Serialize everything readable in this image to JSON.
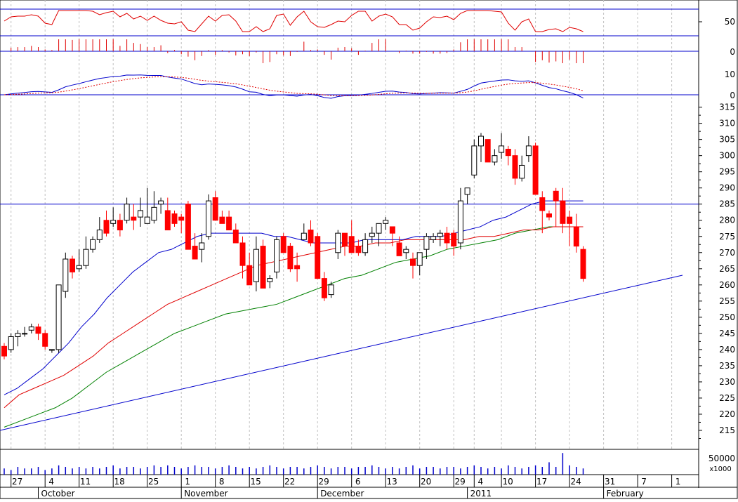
{
  "chart_data": {
    "type": "candlestick",
    "colors": {
      "up": "#ffffff",
      "down": "#ff0000",
      "ma_short": "#0000cc",
      "ma_mid": "#e00000",
      "ma_long": "#008000",
      "trendline": "#0000cc",
      "grid": "#c0c0c0",
      "rsi": "#e00000",
      "osc_bar": "#e00000",
      "macd": "#0000cc",
      "signal": "#e00000",
      "volume": "#0000cc"
    },
    "price_axis": {
      "min": 210,
      "max": 316,
      "ticks": [
        215,
        220,
        225,
        230,
        235,
        240,
        245,
        250,
        255,
        260,
        265,
        270,
        275,
        280,
        285,
        290,
        295,
        300,
        305,
        310,
        315
      ]
    },
    "rsi_panel": {
      "ticks": [
        50
      ],
      "level": 50
    },
    "osc_panel": {
      "ticks": [
        0
      ]
    },
    "macd_panel": {
      "ticks": [
        10,
        0
      ]
    },
    "volume_panel": {
      "ticks": [
        "50000"
      ],
      "unit": "x1000"
    },
    "date_ticks": [
      {
        "label": "27",
        "i": 1
      },
      {
        "label": "4",
        "i": 6
      },
      {
        "label": "11",
        "i": 11
      },
      {
        "label": "18",
        "i": 16
      },
      {
        "label": "25",
        "i": 21
      },
      {
        "label": "1",
        "i": 26
      },
      {
        "label": "8",
        "i": 31
      },
      {
        "label": "15",
        "i": 36
      },
      {
        "label": "22",
        "i": 41
      },
      {
        "label": "29",
        "i": 46
      },
      {
        "label": "6",
        "i": 51
      },
      {
        "label": "13",
        "i": 56
      },
      {
        "label": "20",
        "i": 61
      },
      {
        "label": "29",
        "i": 66
      },
      {
        "label": "4",
        "i": 69
      },
      {
        "label": "10",
        "i": 73
      },
      {
        "label": "17",
        "i": 78
      },
      {
        "label": "24",
        "i": 83
      },
      {
        "label": "31",
        "i": 88
      },
      {
        "label": "7",
        "i": 93
      },
      {
        "label": "1",
        "i": 98
      }
    ],
    "months": [
      {
        "label": "October",
        "i": 5
      },
      {
        "label": "November",
        "i": 26
      },
      {
        "label": "December",
        "i": 46
      },
      {
        "label": "2011",
        "i": 68
      },
      {
        "label": "February",
        "i": 88
      }
    ],
    "candles": [
      [
        241,
        242,
        237,
        238
      ],
      [
        240,
        245,
        239,
        244
      ],
      [
        244,
        246,
        241,
        245
      ],
      [
        245,
        247,
        244,
        245
      ],
      [
        246,
        248,
        245,
        247
      ],
      [
        247,
        248,
        243,
        245
      ],
      [
        245,
        246,
        240,
        241
      ],
      [
        240,
        240,
        239,
        240
      ],
      [
        240,
        260,
        239,
        260
      ],
      [
        258,
        270,
        256,
        268
      ],
      [
        268,
        269,
        262,
        264
      ],
      [
        265,
        271,
        264,
        266
      ],
      [
        266,
        275,
        265,
        271
      ],
      [
        271,
        275,
        270,
        274
      ],
      [
        274,
        281,
        273,
        277
      ],
      [
        280,
        283,
        275,
        276
      ],
      [
        279,
        284,
        278,
        280
      ],
      [
        280,
        282,
        275,
        277
      ],
      [
        280,
        287,
        279,
        285
      ],
      [
        281,
        285,
        277,
        280
      ],
      [
        281,
        287,
        278,
        283
      ],
      [
        279,
        290,
        279,
        281
      ],
      [
        280,
        289,
        279,
        284
      ],
      [
        285,
        287,
        282,
        286
      ],
      [
        283,
        287,
        280,
        277
      ],
      [
        282,
        283,
        278,
        279
      ],
      [
        281,
        282,
        276,
        280
      ],
      [
        285,
        286,
        271,
        271
      ],
      [
        272,
        276,
        271,
        268
      ],
      [
        271,
        276,
        267,
        273
      ],
      [
        275,
        288,
        274,
        286
      ],
      [
        287,
        289,
        281,
        280
      ],
      [
        281,
        283,
        279,
        279
      ],
      [
        281,
        283,
        278,
        277
      ],
      [
        277,
        279,
        274,
        273
      ],
      [
        273,
        275,
        262,
        266
      ],
      [
        266,
        270,
        260,
        260
      ],
      [
        261,
        275,
        258,
        271
      ],
      [
        272,
        274,
        259,
        259
      ],
      [
        261,
        263,
        259,
        262
      ],
      [
        264,
        275,
        262,
        274
      ],
      [
        275,
        276,
        270,
        270
      ],
      [
        272,
        273,
        264,
        265
      ],
      [
        266,
        270,
        261,
        265
      ],
      [
        274,
        279,
        274,
        276
      ],
      [
        277,
        280,
        272,
        273
      ],
      [
        275,
        276,
        262,
        262
      ],
      [
        262,
        264,
        255,
        256
      ],
      [
        257,
        261,
        256,
        260
      ],
      [
        270,
        277,
        268,
        276
      ],
      [
        276,
        276,
        269,
        272
      ],
      [
        275,
        280,
        271,
        270
      ],
      [
        272,
        274,
        269,
        270
      ],
      [
        270,
        276,
        269,
        274
      ],
      [
        275,
        278,
        273,
        276
      ],
      [
        276,
        279,
        272,
        279
      ],
      [
        279,
        281,
        277,
        280
      ],
      [
        278,
        278,
        272,
        276
      ],
      [
        273,
        275,
        269,
        269
      ],
      [
        270,
        272,
        268,
        271
      ],
      [
        268,
        270,
        262,
        266
      ],
      [
        266,
        268,
        263,
        270
      ],
      [
        271,
        276,
        268,
        275
      ],
      [
        274,
        276,
        273,
        275
      ],
      [
        275,
        277,
        272,
        276
      ],
      [
        276,
        278,
        271,
        273
      ],
      [
        276,
        277,
        269,
        272
      ],
      [
        273,
        290,
        271,
        286
      ],
      [
        288,
        290,
        285,
        290
      ],
      [
        294,
        305,
        293,
        303
      ],
      [
        303,
        307,
        298,
        306
      ],
      [
        305,
        305,
        298,
        298
      ],
      [
        298,
        302,
        297,
        300
      ],
      [
        301,
        307,
        299,
        303
      ],
      [
        302,
        303,
        297,
        300
      ],
      [
        300,
        302,
        291,
        293
      ],
      [
        293,
        300,
        292,
        297
      ],
      [
        300,
        306,
        298,
        303
      ],
      [
        303,
        304,
        288,
        288
      ],
      [
        287,
        289,
        276,
        283
      ],
      [
        282,
        283,
        280,
        281
      ],
      [
        289,
        290,
        278,
        286
      ],
      [
        286,
        290,
        276,
        279
      ],
      [
        281,
        283,
        272,
        279
      ],
      [
        278,
        282,
        270,
        272
      ],
      [
        271,
        272,
        261,
        262
      ]
    ],
    "ma_short": [
      226,
      228,
      231,
      234,
      238,
      242,
      247,
      251,
      256,
      260,
      264,
      267,
      270,
      271,
      273,
      275,
      276,
      276,
      276,
      276,
      276,
      275,
      275,
      274,
      273,
      273,
      273,
      273,
      274,
      274,
      274,
      274,
      275,
      275,
      275,
      276,
      277,
      278,
      280,
      281,
      283,
      285,
      286,
      286,
      286,
      286
    ],
    "ma_mid": [
      222,
      226,
      228,
      230,
      232,
      235,
      238,
      242,
      245,
      248,
      251,
      254,
      256,
      258,
      260,
      262,
      264,
      266,
      267,
      268,
      269,
      270,
      271,
      272,
      272,
      273,
      273,
      274,
      274,
      274,
      274,
      274,
      275,
      275,
      276,
      277,
      277,
      278,
      278,
      278
    ],
    "ma_long": [
      216,
      218,
      220,
      222,
      225,
      229,
      233,
      236,
      239,
      242,
      245,
      247,
      249,
      251,
      252,
      253,
      254,
      256,
      258,
      260,
      262,
      263,
      265,
      267,
      268,
      269,
      271,
      272,
      273,
      274,
      276,
      277,
      278,
      278,
      278
    ],
    "trendline": {
      "from": [
        0,
        215
      ],
      "to": [
        100,
        263
      ]
    },
    "hline": 285,
    "volume": [
      4,
      3,
      5,
      4,
      4,
      5,
      3,
      4,
      6,
      5,
      4,
      5,
      4,
      5,
      4,
      5,
      6,
      4,
      5,
      5,
      4,
      5,
      6,
      5,
      6,
      5,
      4,
      5,
      6,
      5,
      5,
      4,
      5,
      6,
      5,
      4,
      5,
      4,
      5,
      6,
      5,
      4,
      5,
      5,
      4,
      5,
      6,
      5,
      4,
      5,
      5,
      4,
      5,
      5,
      6,
      5,
      4,
      5,
      4,
      5,
      6,
      4,
      5,
      5,
      4,
      5,
      5,
      4,
      5,
      6,
      5,
      4,
      5,
      4,
      6,
      5,
      4,
      5,
      6,
      5,
      8,
      5,
      14,
      6,
      5,
      4
    ]
  }
}
